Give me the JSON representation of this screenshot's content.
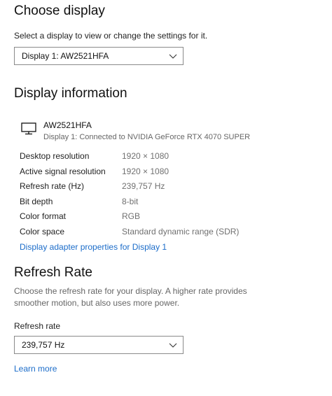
{
  "choose_display": {
    "title": "Choose display",
    "description": "Select a display to view or change the settings for it.",
    "selected_display": "Display 1: AW2521HFA"
  },
  "display_information": {
    "title": "Display information",
    "monitor_name": "AW2521HFA",
    "connection": "Display 1: Connected to NVIDIA GeForce RTX 4070 SUPER",
    "rows": [
      {
        "label": "Desktop resolution",
        "value": "1920 × 1080"
      },
      {
        "label": "Active signal resolution",
        "value": "1920 × 1080"
      },
      {
        "label": "Refresh rate (Hz)",
        "value": "239,757 Hz"
      },
      {
        "label": "Bit depth",
        "value": "8-bit"
      },
      {
        "label": "Color format",
        "value": "RGB"
      },
      {
        "label": "Color space",
        "value": "Standard dynamic range (SDR)"
      }
    ],
    "adapter_link": "Display adapter properties for Display 1"
  },
  "refresh_rate": {
    "title": "Refresh Rate",
    "description_line1": "Choose the refresh rate for your display. A higher rate provides",
    "description_line2": "smoother motion, but also uses more power.",
    "field_label": "Refresh rate",
    "selected_rate": "239,757 Hz",
    "learn_more": "Learn more"
  },
  "colors": {
    "link": "#1b6cc9",
    "value_text": "#707070"
  }
}
